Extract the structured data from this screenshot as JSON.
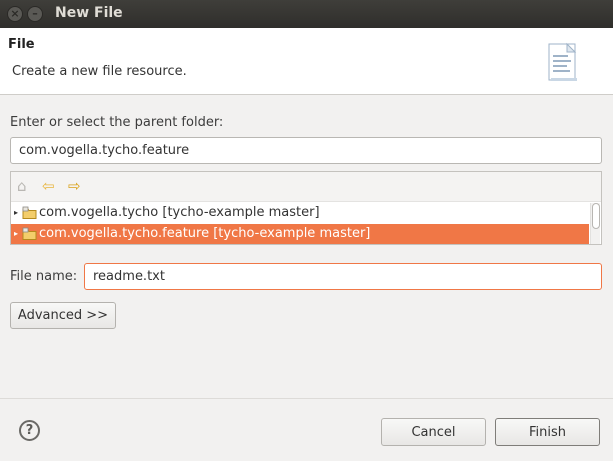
{
  "window": {
    "title": "New File",
    "close_glyph": "×",
    "min_glyph": "–"
  },
  "header": {
    "title": "File",
    "description": "Create a new file resource.",
    "icon": "document-icon"
  },
  "parent_folder": {
    "label": "Enter or select the parent folder:",
    "value": "com.vogella.tycho.feature"
  },
  "tree": {
    "toolbar": {
      "home_glyph": "⌂",
      "back_glyph": "⇦",
      "forward_glyph": "⇨"
    },
    "items": [
      {
        "label": "com.vogella.tycho [tycho-example master]",
        "selected": false
      },
      {
        "label": "com.vogella.tycho.feature [tycho-example master]",
        "selected": true
      }
    ],
    "expand_glyph": "▸"
  },
  "file_name": {
    "label": "File name:",
    "value": "readme.txt"
  },
  "buttons": {
    "advanced": "Advanced >>",
    "cancel": "Cancel",
    "finish": "Finish",
    "help": "?"
  },
  "colors": {
    "selection": "#f07746",
    "titlebar": "#3c3b37",
    "folder": "#d9a21b"
  }
}
